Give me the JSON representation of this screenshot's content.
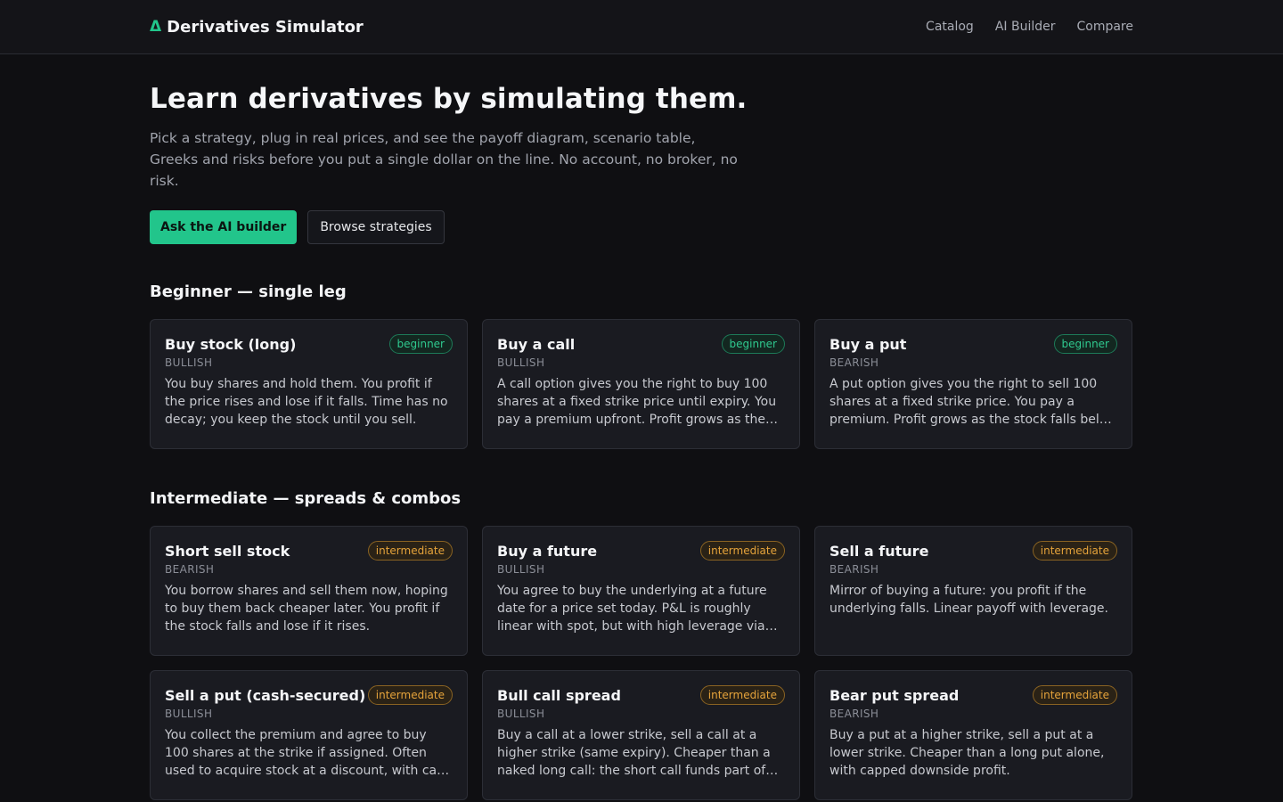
{
  "header": {
    "logo_glyph": "Δ",
    "title": "Derivatives Simulator",
    "nav": [
      "Catalog",
      "AI Builder",
      "Compare"
    ]
  },
  "hero": {
    "title": "Learn derivatives by simulating them.",
    "subtitle": "Pick a strategy, plug in real prices, and see the payoff diagram, scenario table, Greeks and risks before you put a single dollar on the line. No account, no broker, no risk.",
    "primary_button": "Ask the AI builder",
    "secondary_button": "Browse strategies"
  },
  "sections": [
    {
      "title": "Beginner — single leg",
      "cards": [
        {
          "title": "Buy stock (long)",
          "badge": "beginner",
          "direction": "BULLISH",
          "description": "You buy shares and hold them. You profit if the price rises and lose if it falls. Time has no decay; you keep the stock until you sell."
        },
        {
          "title": "Buy a call",
          "badge": "beginner",
          "direction": "BULLISH",
          "description": "A call option gives you the right to buy 100 shares at a fixed strike price until expiry. You pay a premium upfront. Profit grows as the…"
        },
        {
          "title": "Buy a put",
          "badge": "beginner",
          "direction": "BEARISH",
          "description": "A put option gives you the right to sell 100 shares at a fixed strike price. You pay a premium. Profit grows as the stock falls bel…"
        }
      ]
    },
    {
      "title": "Intermediate — spreads & combos",
      "cards": [
        {
          "title": "Short sell stock",
          "badge": "intermediate",
          "direction": "BEARISH",
          "description": "You borrow shares and sell them now, hoping to buy them back cheaper later. You profit if the stock falls and lose if it rises."
        },
        {
          "title": "Buy a future",
          "badge": "intermediate",
          "direction": "BULLISH",
          "description": "You agree to buy the underlying at a future date for a price set today. P&L is roughly linear with spot, but with high leverage via…"
        },
        {
          "title": "Sell a future",
          "badge": "intermediate",
          "direction": "BEARISH",
          "description": "Mirror of buying a future: you profit if the underlying falls. Linear payoff with leverage."
        },
        {
          "title": "Sell a put (cash-secured)",
          "badge": "intermediate",
          "direction": "BULLISH",
          "description": "You collect the premium and agree to buy 100 shares at the strike if assigned. Often used to acquire stock at a discount, with ca…"
        },
        {
          "title": "Bull call spread",
          "badge": "intermediate",
          "direction": "BULLISH",
          "description": "Buy a call at a lower strike, sell a call at a higher strike (same expiry). Cheaper than a naked long call: the short call funds part of…"
        },
        {
          "title": "Bear put spread",
          "badge": "intermediate",
          "direction": "BEARISH",
          "description": "Buy a put at a higher strike, sell a put at a lower strike. Cheaper than a long put alone, with capped downside profit."
        }
      ]
    }
  ],
  "colors": {
    "accent": "#22c58b",
    "background": "#0f0f12",
    "card": "#1a1b21",
    "beginner_badge": "#2fc98f",
    "intermediate_badge": "#e5a33b"
  }
}
